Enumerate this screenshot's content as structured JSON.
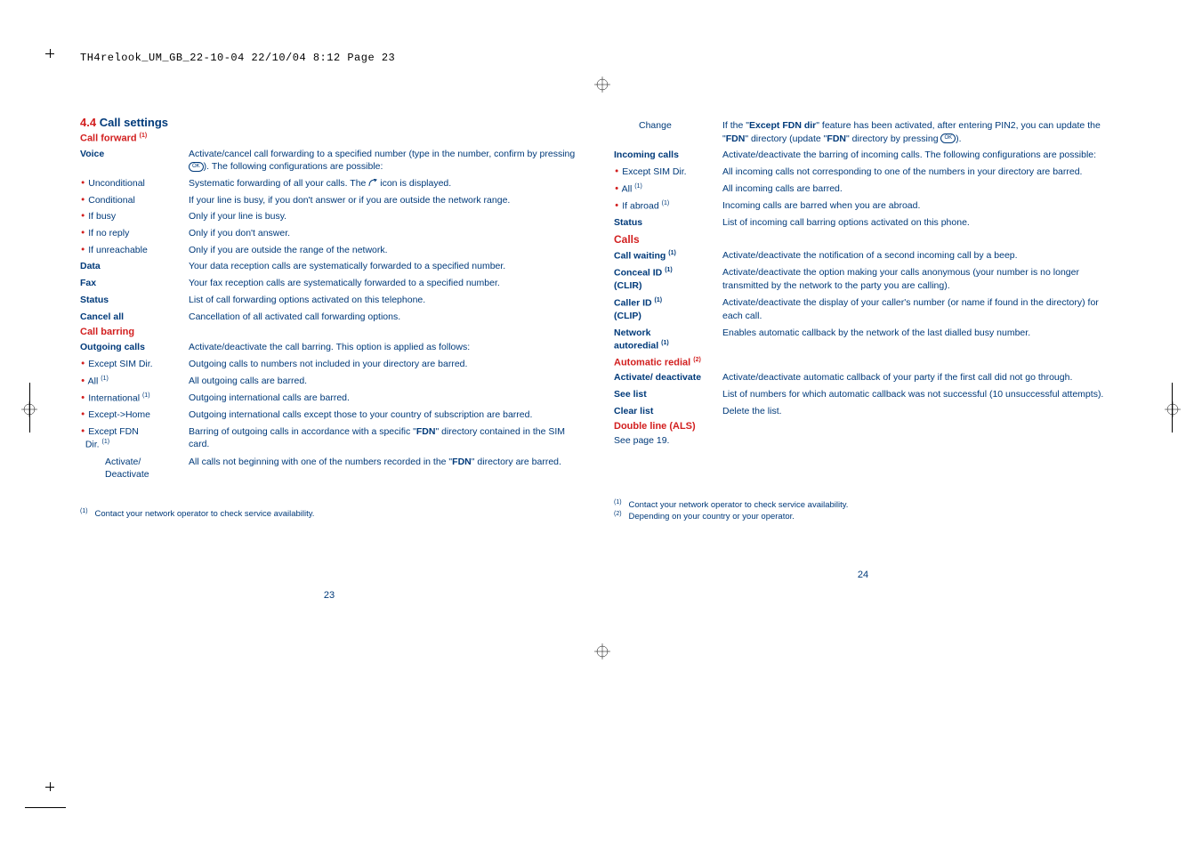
{
  "header": "TH4relook_UM_GB_22-10-04  22/10/04  8:12  Page 23",
  "left": {
    "sect_num": "4.4",
    "sect_title": "Call settings",
    "call_forward": "Call forward",
    "voice_lbl": "Voice",
    "voice_val": "Activate/cancel call forwarding to a specified number (type in the number, confirm by pressing ",
    "voice_val2": "). The following configurations are possible:",
    "uncond_lbl": "Unconditional",
    "uncond_val": "Systematic forwarding of all your calls. The ",
    "uncond_val2": " icon is displayed.",
    "cond_lbl": "Conditional",
    "cond_val": "If your line is busy, if you don't answer or if you are outside the network range.",
    "busy_lbl": "If busy",
    "busy_val": "Only if your line is busy.",
    "noreply_lbl": "If no reply",
    "noreply_val": "Only if you don't answer.",
    "unreach_lbl": "If unreachable",
    "unreach_val": "Only if you are outside the range of the network.",
    "data_lbl": "Data",
    "data_val": "Your data reception calls are systematically forwarded to a specified number.",
    "fax_lbl": "Fax",
    "fax_val": "Your fax reception calls are systematically forwarded to a specified number.",
    "status_lbl": "Status",
    "status_val": "List of call forwarding options activated on this telephone.",
    "cancel_lbl": "Cancel all",
    "cancel_val": "Cancellation of all activated call forwarding options.",
    "call_barring": "Call barring",
    "out_lbl": "Outgoing calls",
    "out_val": "Activate/deactivate the call barring. This option is applied as follows:",
    "esim_lbl": "Except SIM Dir.",
    "esim_val": "Outgoing calls to numbers not included in your directory are barred.",
    "all_lbl": "All",
    "all_val": "All outgoing calls are barred.",
    "intl_lbl": "International",
    "intl_val": "Outgoing international calls are barred.",
    "exh_lbl": "Except->Home",
    "exh_val": "Outgoing international calls except those to your country of subscription are barred.",
    "efdn_lbl1": "Except FDN",
    "efdn_lbl2": "Dir.",
    "efdn_val": "Barring of outgoing calls in accordance with a specific \"",
    "efdn_val_b": "FDN",
    "efdn_val2": "\" directory contained in the SIM card.",
    "act_lbl": "Activate/ Deactivate",
    "act_val": "All calls not beginning with one of the numbers recorded in the \"",
    "act_val_b": "FDN",
    "act_val2": "\" directory are barred.",
    "footnote": "Contact your network operator to check service availability.",
    "pagenum": "23"
  },
  "right": {
    "change_lbl": "Change",
    "change_val1": "If the \"",
    "change_val_b1": "Except FDN dir",
    "change_val2": "\" feature has been activated, after entering PIN2, you can update the \"",
    "change_val_b2": "FDN",
    "change_val3": "\" directory (update \"",
    "change_val_b3": "FDN",
    "change_val4": "\" directory by pressing ",
    "change_val5": ").",
    "inc_lbl": "Incoming calls",
    "inc_val": "Activate/deactivate the barring of incoming calls. The following configurations are possible:",
    "esim_lbl": "Except SIM Dir.",
    "esim_val": "All incoming calls not corresponding to one of the numbers in your directory are barred.",
    "all_lbl": "All",
    "all_val": "All incoming calls are barred.",
    "abr_lbl": "If abroad",
    "abr_val": "Incoming calls are barred when you are abroad.",
    "status_lbl": "Status",
    "status_val": "List of incoming call barring options activated on this phone.",
    "calls": "Calls",
    "cw_lbl": "Call waiting",
    "cw_val": "Activate/deactivate the notification of a second incoming call by a beep.",
    "conc_lbl": "Conceal ID",
    "conc_lbl2": "(CLIR)",
    "conc_val": "Activate/deactivate the option making your calls anonymous (your number is no longer transmitted by the network to the party you are calling).",
    "cid_lbl": "Caller ID",
    "cid_lbl2": "(CLIP)",
    "cid_val": "Activate/deactivate the display of your caller's number (or name if found in the directory) for each call.",
    "net_lbl": "Network",
    "net_lbl2": "autoredial",
    "net_val": "Enables automatic callback by the network of the last dialled busy number.",
    "auto_redial": "Automatic redial",
    "act_lbl": "Activate/ deactivate",
    "act_val": "Activate/deactivate automatic callback of your party if the first call did not go through.",
    "see_lbl": "See list",
    "see_val": "List of numbers for which automatic callback was not successful (10 unsuccessful attempts).",
    "clr_lbl": "Clear list",
    "clr_val": "Delete the list.",
    "dbl": "Double line (ALS)",
    "seepage": "See page 19.",
    "fn1": "Contact your network operator to check service availability.",
    "fn2": "Depending on your country or your operator.",
    "pagenum": "24"
  }
}
